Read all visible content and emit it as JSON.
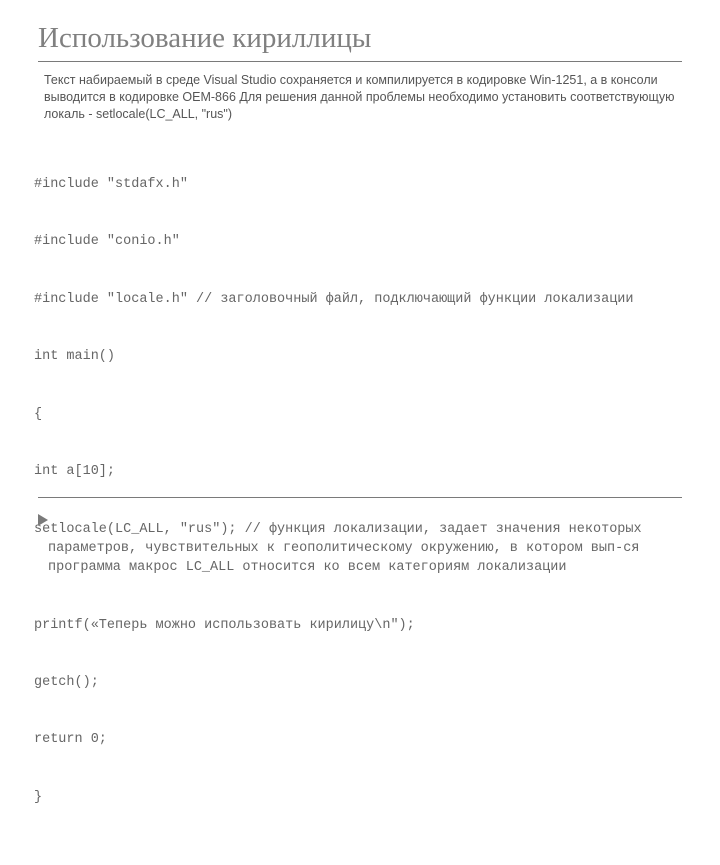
{
  "title": "Использование кириллицы",
  "intro": "Текст набираемый в среде Visual Studio сохраняется и компилируется в кодировке Win-1251, а в консоли выводится в кодировке OEM-866 Для решения данной проблемы необходимо установить соответствующую локаль - setlocale(LC_ALL, \"rus\")",
  "code": {
    "l1": "#include \"stdafx.h\"",
    "l2": "#include \"conio.h\"",
    "l3": "#include \"locale.h\" // заголовочный файл, подключающий функции локализации",
    "l4": "int main()",
    "l5": "{",
    "l6": "int a[10];",
    "l7": "setlocale(LC_ALL, \"rus\"); // функция локализации, задает значения некоторых параметров, чувствительных к геополитическому окружению, в котором вып-ся программа макрос LC_ALL относится ко всем категориям локализации",
    "l8": "printf(«Теперь можно использовать кирилицу\\n\");",
    "l9": "getch();",
    "l10": "return 0;",
    "l11": "}"
  }
}
